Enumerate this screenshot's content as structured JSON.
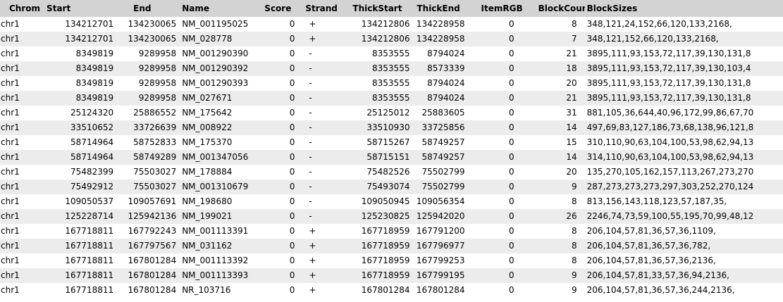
{
  "columns": [
    "Chrom",
    "Start",
    "End",
    "Name",
    "Score",
    "Strand",
    "ThickStart",
    "ThickEnd",
    "ItemRGB",
    "BlockCount",
    "BlockSizes"
  ],
  "rows": [
    [
      "chr1",
      "134212701",
      "134230065",
      "NM_001195025",
      "0",
      "+",
      "134212806",
      "134228958",
      "0",
      "8",
      "348,121,24,152,66,120,133,2168,"
    ],
    [
      "chr1",
      "134212701",
      "134230065",
      "NM_028778",
      "0",
      "+",
      "134212806",
      "134228958",
      "0",
      "7",
      "348,121,152,66,120,133,2168,"
    ],
    [
      "chr1",
      "8349819",
      "9289958",
      "NM_001290390",
      "0",
      "-",
      "8353555",
      "8794024",
      "0",
      "21",
      "3895,111,93,153,72,117,39,130,131,8"
    ],
    [
      "chr1",
      "8349819",
      "9289958",
      "NM_001290392",
      "0",
      "-",
      "8353555",
      "8573339",
      "0",
      "18",
      "3895,111,93,153,72,117,39,130,103,4"
    ],
    [
      "chr1",
      "8349819",
      "9289958",
      "NM_001290393",
      "0",
      "-",
      "8353555",
      "8794024",
      "0",
      "20",
      "3895,111,93,153,72,117,39,130,131,8"
    ],
    [
      "chr1",
      "8349819",
      "9289958",
      "NM_027671",
      "0",
      "-",
      "8353555",
      "8794024",
      "0",
      "21",
      "3895,111,93,153,72,117,39,130,131,8"
    ],
    [
      "chr1",
      "25124320",
      "25886552",
      "NM_175642",
      "0",
      "-",
      "25125012",
      "25883605",
      "0",
      "31",
      "881,105,36,644,40,96,172,99,86,67,70"
    ],
    [
      "chr1",
      "33510652",
      "33726639",
      "NM_008922",
      "0",
      "-",
      "33510930",
      "33725856",
      "0",
      "14",
      "497,69,83,127,186,73,68,138,96,121,8"
    ],
    [
      "chr1",
      "58714964",
      "58752833",
      "NM_175370",
      "0",
      "-",
      "58715267",
      "58749257",
      "0",
      "15",
      "310,110,90,63,104,100,53,98,62,94,13"
    ],
    [
      "chr1",
      "58714964",
      "58749289",
      "NM_001347056",
      "0",
      "-",
      "58715151",
      "58749257",
      "0",
      "14",
      "314,110,90,63,104,100,53,98,62,94,13"
    ],
    [
      "chr1",
      "75482399",
      "75503027",
      "NM_178884",
      "0",
      "-",
      "75482526",
      "75502799",
      "0",
      "20",
      "135,270,105,162,157,113,267,273,270"
    ],
    [
      "chr1",
      "75492912",
      "75503027",
      "NM_001310679",
      "0",
      "-",
      "75493074",
      "75502799",
      "0",
      "9",
      "287,273,273,273,297,303,252,270,124"
    ],
    [
      "chr1",
      "109050537",
      "109057691",
      "NM_198680",
      "0",
      "-",
      "109050945",
      "109056354",
      "0",
      "8",
      "813,156,143,118,123,57,187,35,"
    ],
    [
      "chr1",
      "125228714",
      "125942136",
      "NM_199021",
      "0",
      "-",
      "125230825",
      "125942020",
      "0",
      "26",
      "2246,74,73,59,100,55,195,70,99,48,12"
    ],
    [
      "chr1",
      "167718811",
      "167792243",
      "NM_001113391",
      "0",
      "+",
      "167718959",
      "167791200",
      "0",
      "8",
      "206,104,57,81,36,57,36,1109,"
    ],
    [
      "chr1",
      "167718811",
      "167797567",
      "NM_031162",
      "0",
      "+",
      "167718959",
      "167796977",
      "0",
      "8",
      "206,104,57,81,36,57,36,782,"
    ],
    [
      "chr1",
      "167718811",
      "167801284",
      "NM_001113392",
      "0",
      "+",
      "167718959",
      "167799253",
      "0",
      "8",
      "206,104,57,81,36,57,36,2136,"
    ],
    [
      "chr1",
      "167718811",
      "167801284",
      "NM_001113393",
      "0",
      "+",
      "167718959",
      "167799195",
      "0",
      "9",
      "206,104,57,81,33,57,36,94,2136,"
    ],
    [
      "chr1",
      "167718811",
      "167801284",
      "NR_103716",
      "0",
      "+",
      "167801284",
      "167801284",
      "0",
      "9",
      "206,104,57,81,36,57,36,244,2136,"
    ]
  ]
}
